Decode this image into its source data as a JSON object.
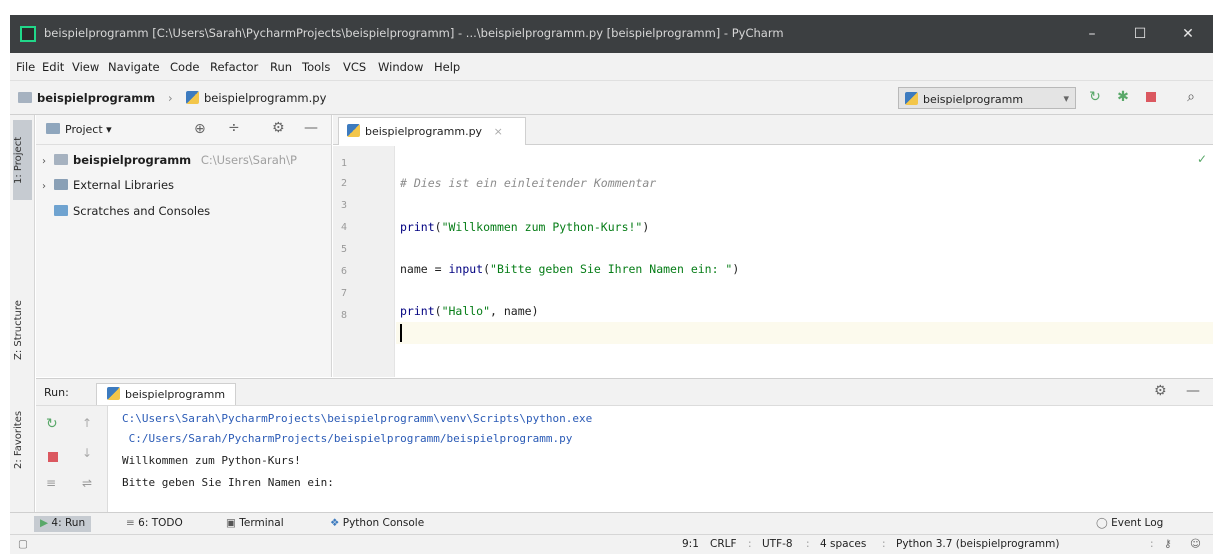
{
  "window": {
    "title": "beispielprogramm [C:\\Users\\Sarah\\PycharmProjects\\beispielprogramm] - ...\\beispielprogramm.py [beispielprogramm] - PyCharm",
    "controls": {
      "minimize": "–",
      "maximize": "☐",
      "close": "✕"
    }
  },
  "menu": [
    "File",
    "Edit",
    "View",
    "Navigate",
    "Code",
    "Refactor",
    "Run",
    "Tools",
    "VCS",
    "Window",
    "Help"
  ],
  "breadcrumb": {
    "project": "beispielprogramm",
    "file": "beispielprogramm.py"
  },
  "run_config": {
    "selected": "beispielprogramm",
    "arrow": "▾"
  },
  "toolbar_icons": [
    "run-icon",
    "debug-icon",
    "stop-icon",
    "search-icon"
  ],
  "project_panel": {
    "title": "Project",
    "tree": [
      {
        "label": "beispielprogramm",
        "hint": "C:\\Users\\Sarah\\P",
        "expandable": true
      },
      {
        "label": "External Libraries",
        "expandable": true
      },
      {
        "label": "Scratches and Consoles",
        "expandable": false
      }
    ]
  },
  "side_tabs": {
    "project": "1: Project",
    "structure": "Z: Structure",
    "favorites": "2: Favorites"
  },
  "editor": {
    "tab": "beispielprogramm.py",
    "line_numbers": [
      "1",
      "2",
      "3",
      "4",
      "5",
      "6",
      "7",
      "8"
    ],
    "lines": [
      {
        "comment": "# Dies ist ein einleitender Kommentar"
      },
      {
        "fn": "print",
        "open": "(",
        "str": "\"Willkommen zum Python-Kurs!\"",
        "close": ")"
      },
      {
        "plain": "name = ",
        "fn": "input",
        "open": "(",
        "str": "\"Bitte geben Sie Ihren Namen ein: \"",
        "close": ")"
      },
      {
        "fn": "print",
        "open": "(",
        "str": "\"Hallo\"",
        "close": ", name)"
      }
    ]
  },
  "run_panel": {
    "label": "Run:",
    "tab": "beispielprogramm",
    "output": [
      "C:\\Users\\Sarah\\PycharmProjects\\beispielprogramm\\venv\\Scripts\\python.exe",
      " C:/Users/Sarah/PycharmProjects/beispielprogramm/beispielprogramm.py",
      "Willkommen zum Python-Kurs!",
      "Bitte geben Sie Ihren Namen ein:"
    ]
  },
  "bottom_tabs": [
    "4: Run",
    "6: TODO",
    "Terminal",
    "Python Console"
  ],
  "event_log": "Event Log",
  "status": {
    "position": "9:1",
    "line_sep": "CRLF",
    "encoding": "UTF-8",
    "indent": "4 spaces",
    "interpreter": "Python 3.7 (beispielprogramm)"
  },
  "colors": {
    "titlebar": "#3c3f41",
    "string": "#067d17",
    "function": "#000080",
    "comment": "#8c8c8c",
    "run_green": "#59a869",
    "stop_red": "#db5860"
  }
}
